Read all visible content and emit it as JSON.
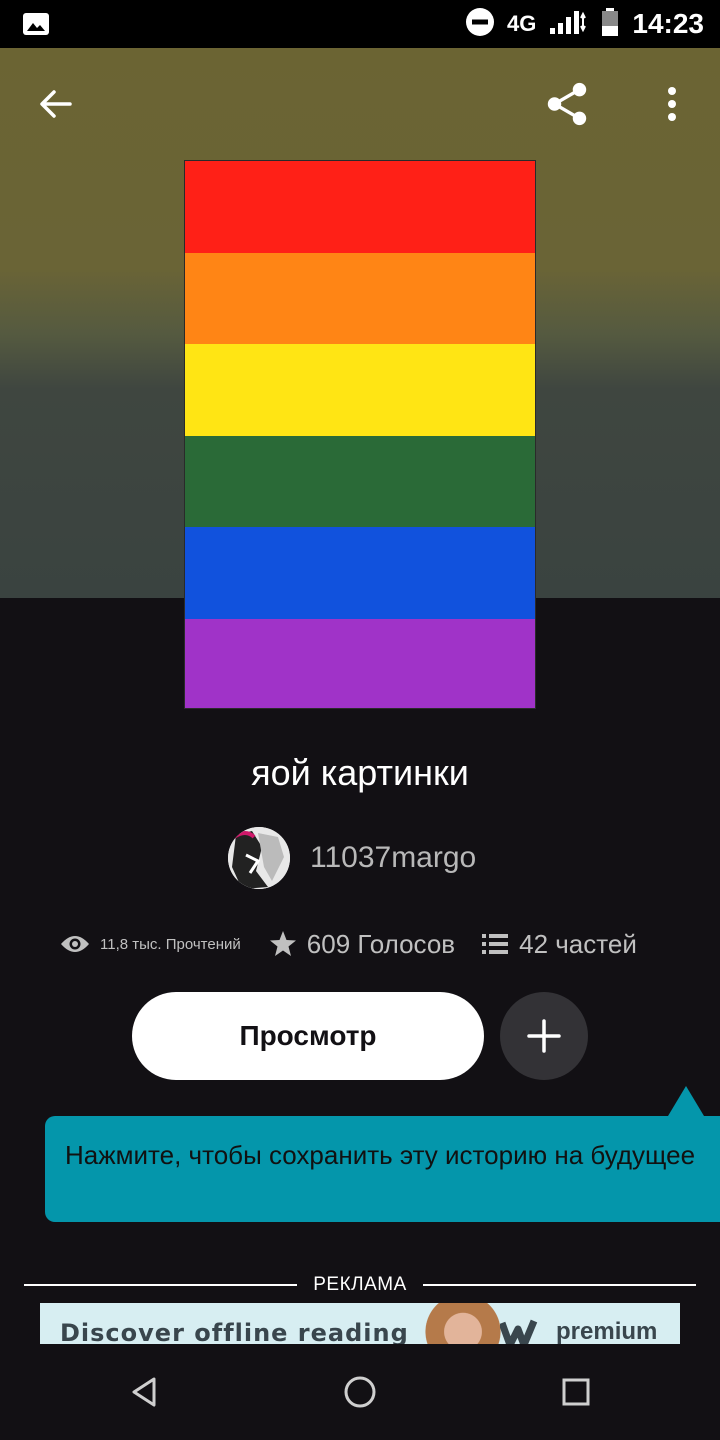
{
  "status_bar": {
    "time": "14:23",
    "network": "4G"
  },
  "cover": {
    "stripes": [
      "#ff2017",
      "#ff8515",
      "#ffe514",
      "#2a6a37",
      "#1152dd",
      "#a033c8"
    ]
  },
  "story": {
    "title": "яой картинки",
    "author": "11037margo"
  },
  "stats": {
    "reads": "11,8 тыс. Прочтений",
    "votes": "609 Голосов",
    "parts": "42 частей"
  },
  "actions": {
    "view_label": "Просмотр"
  },
  "tooltip": {
    "text": "Нажмите, чтобы сохранить эту историю на будущее"
  },
  "ad": {
    "label": "РЕКЛАМА",
    "headline": "Discover offline reading",
    "brand_word": "premium"
  },
  "colors": {
    "accent": "#0496ab",
    "background": "#121014"
  }
}
